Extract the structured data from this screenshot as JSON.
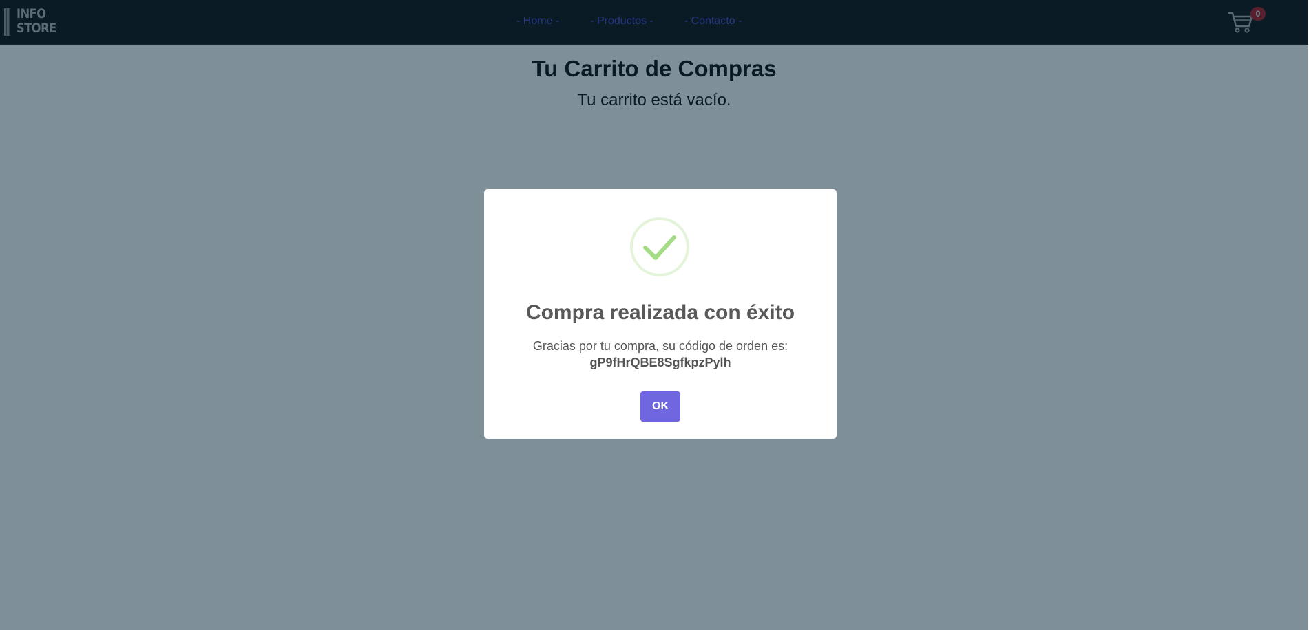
{
  "navbar": {
    "logo": {
      "line1": "INFO",
      "line2": "STORE"
    },
    "links": [
      {
        "label": "- Home -"
      },
      {
        "label": "- Productos -"
      },
      {
        "label": "- Contacto -"
      }
    ],
    "cart": {
      "icon": "cart-icon",
      "count": "0"
    }
  },
  "page": {
    "title": "Tu Carrito de Compras",
    "empty_message": "Tu carrito está vacío."
  },
  "modal": {
    "icon": "check-icon",
    "title": "Compra realizada con éxito",
    "message": "Gracias por tu compra, su código de orden es:",
    "order_code": "gP9fHrQBE8SgfkpzPylh",
    "confirm_label": "OK"
  },
  "colors": {
    "navbar_bg": "#14171c",
    "nav_link": "#4e4ed8",
    "badge_bg": "#b01e2c",
    "success_green": "#a5dc86",
    "ok_button": "#7066e0"
  }
}
